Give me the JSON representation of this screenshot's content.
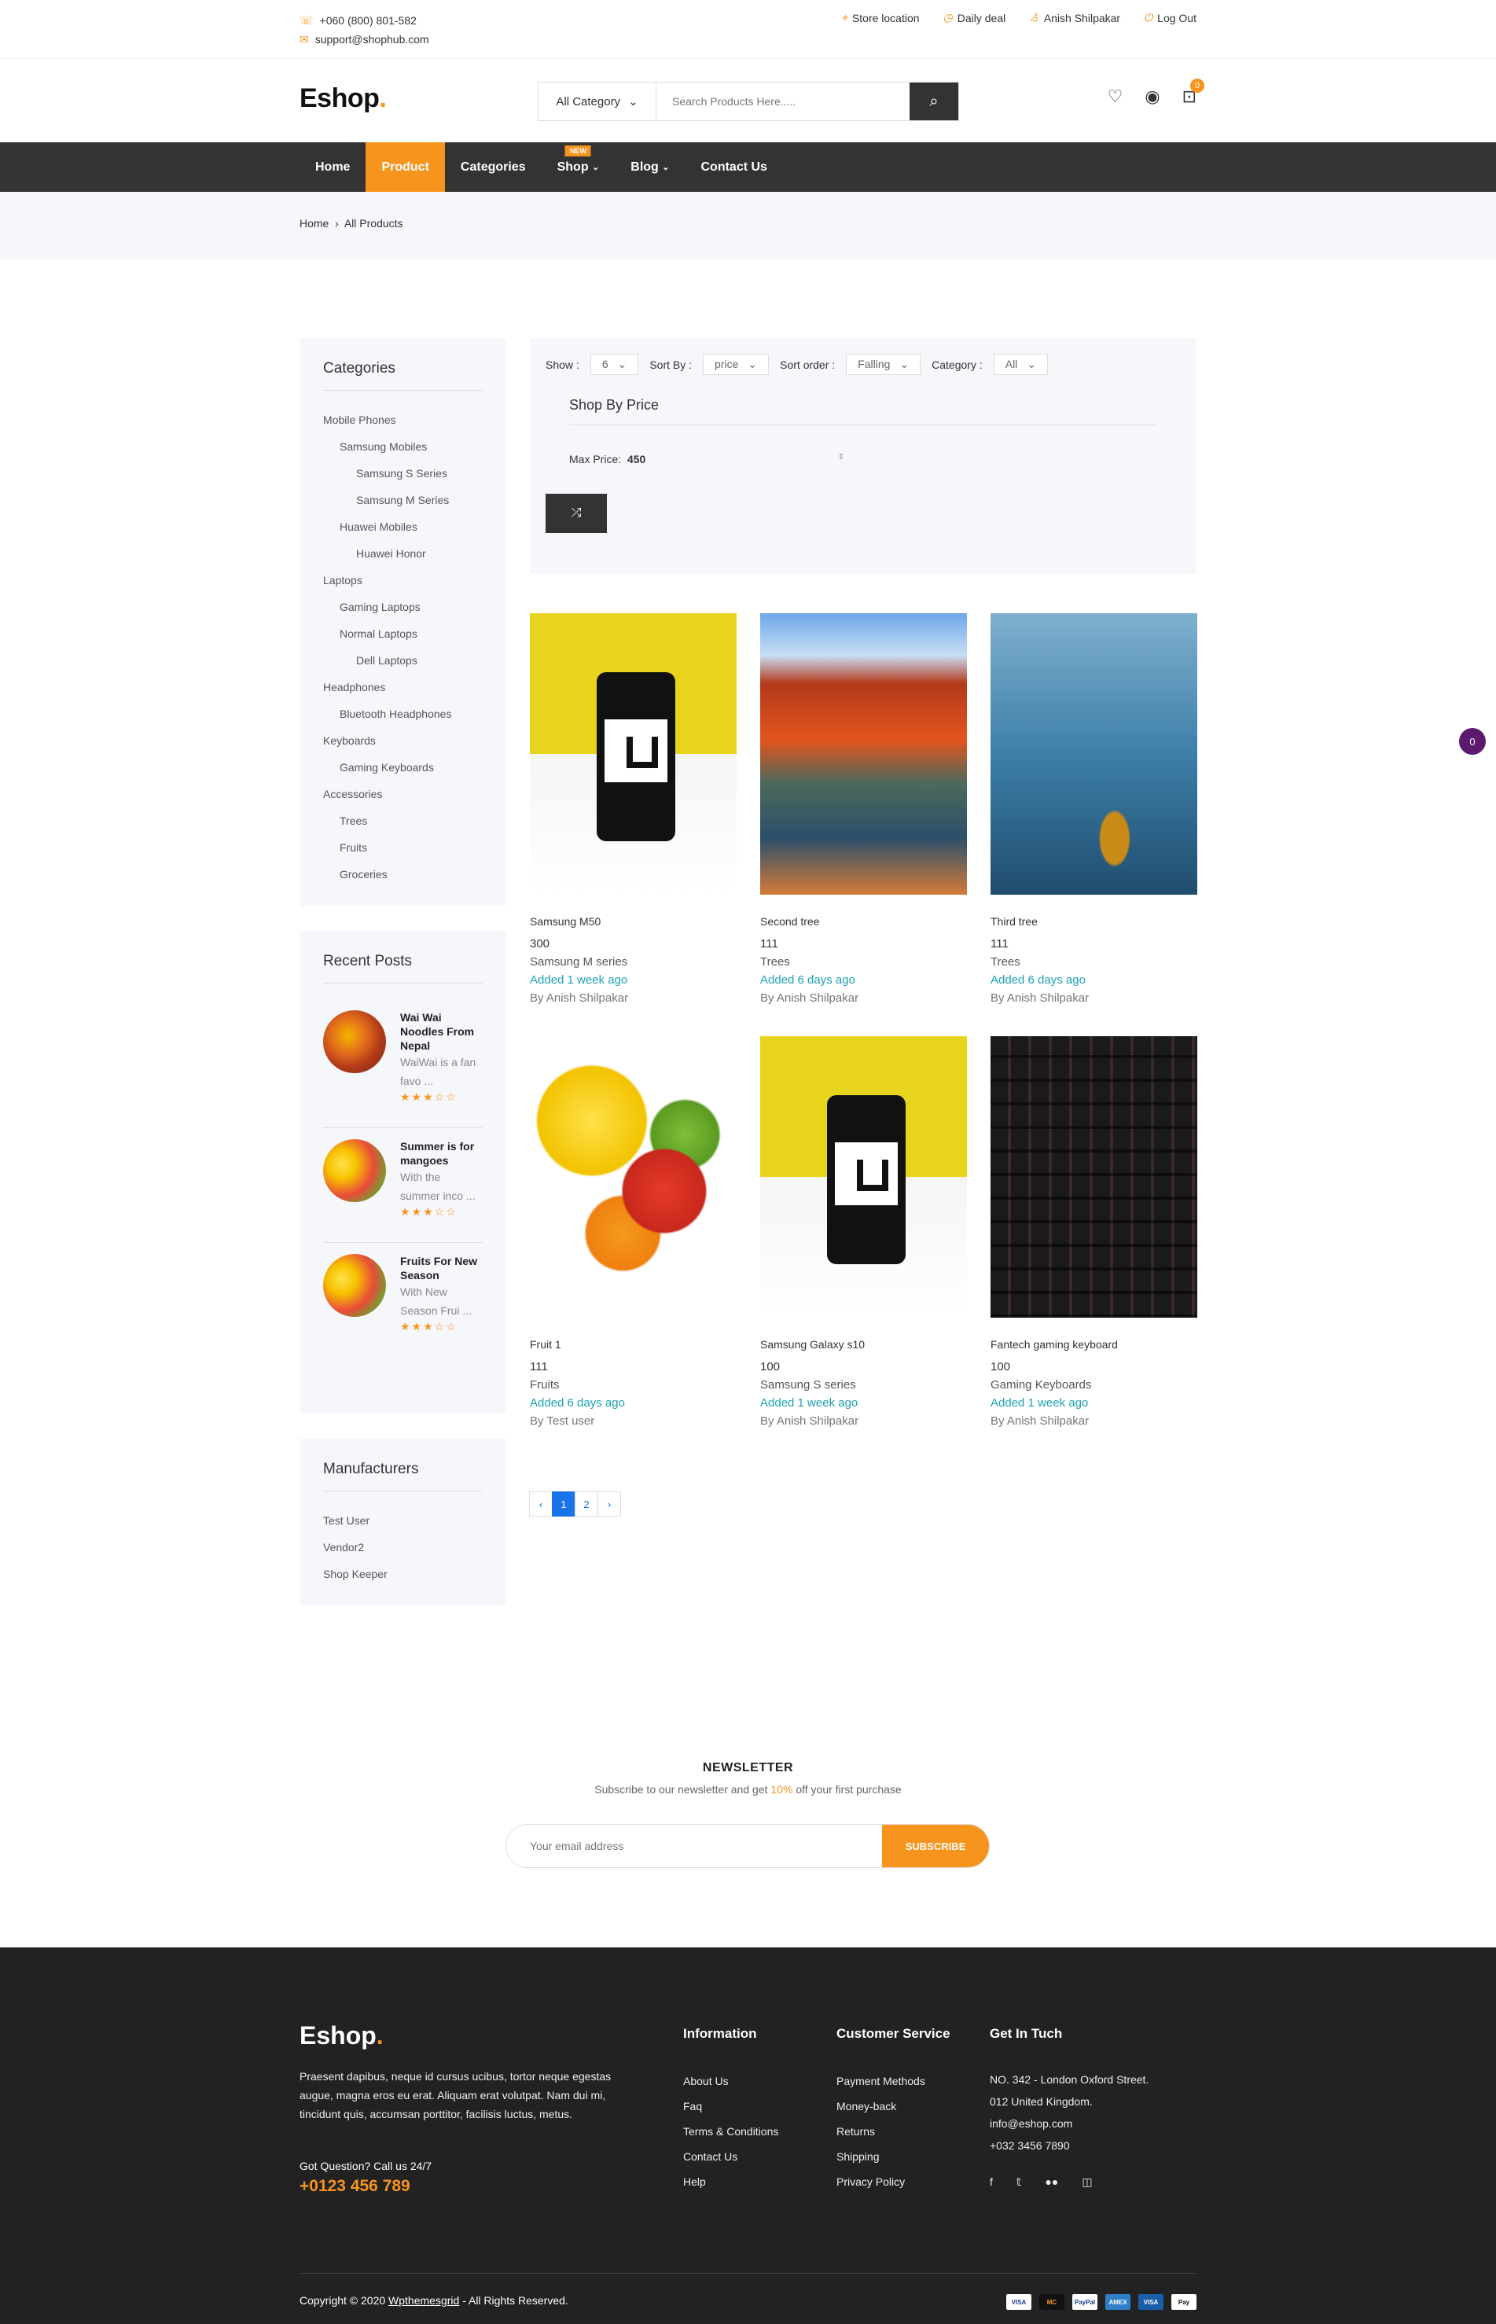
{
  "topbar": {
    "phone": "+060 (800) 801-582",
    "email": "support@shophub.com",
    "store_location": "Store location",
    "daily_deal": "Daily deal",
    "user": "Anish Shilpakar",
    "logout": "Log Out"
  },
  "header": {
    "logo": "Eshop",
    "logo_dot": ".",
    "category_select": "All Category",
    "search_placeholder": "Search Products Here.....",
    "cart_count": "0"
  },
  "nav": {
    "items": [
      {
        "label": "Home"
      },
      {
        "label": "Product"
      },
      {
        "label": "Categories"
      },
      {
        "label": "Shop",
        "badge": "NEW"
      },
      {
        "label": "Blog"
      },
      {
        "label": "Contact Us"
      }
    ]
  },
  "breadcrumb": {
    "home": "Home",
    "sep": "›",
    "current": "All Products"
  },
  "sidebar": {
    "categories_title": "Categories",
    "categories": [
      {
        "label": "Mobile Phones",
        "level": 0
      },
      {
        "label": "Samsung Mobiles",
        "level": 1
      },
      {
        "label": "Samsung S Series",
        "level": 2
      },
      {
        "label": "Samsung M Series",
        "level": 2
      },
      {
        "label": "Huawei Mobiles",
        "level": 1
      },
      {
        "label": "Huawei Honor",
        "level": 2
      },
      {
        "label": "Laptops",
        "level": 0
      },
      {
        "label": "Gaming Laptops",
        "level": 1
      },
      {
        "label": "Normal Laptops",
        "level": 1
      },
      {
        "label": "Dell Laptops",
        "level": 2
      },
      {
        "label": "Headphones",
        "level": 0
      },
      {
        "label": "Bluetooth Headphones",
        "level": 1
      },
      {
        "label": "Keyboards",
        "level": 0
      },
      {
        "label": "Gaming Keyboards",
        "level": 1
      },
      {
        "label": "Accessories",
        "level": 0
      },
      {
        "label": "Trees",
        "level": 1
      },
      {
        "label": "Fruits",
        "level": 1
      },
      {
        "label": "Groceries",
        "level": 1
      }
    ],
    "recent_title": "Recent Posts",
    "posts": [
      {
        "title": "Wai Wai Noodles From Nepal",
        "excerpt": "WaiWai is a fan favo ...",
        "stars": "★★★☆☆"
      },
      {
        "title": "Summer is for mangoes",
        "excerpt": "With the summer inco ...",
        "stars": "★★★☆☆"
      },
      {
        "title": "Fruits For New Season",
        "excerpt": "With New Season Frui ...",
        "stars": "★★★☆☆"
      }
    ],
    "manufacturers_title": "Manufacturers",
    "manufacturers": [
      "Test User",
      "Vendor2",
      "Shop Keeper"
    ]
  },
  "filter": {
    "show_label": "Show :",
    "show_value": "6",
    "sort_by_label": "Sort By :",
    "sort_by_value": "price",
    "sort_order_label": "Sort order :",
    "sort_order_value": "Falling",
    "category_label": "Category :",
    "category_value": "All",
    "shop_by_price": "Shop By Price",
    "max_price_label": "Max Price:",
    "max_price_value": "450"
  },
  "products": [
    {
      "title": "Samsung M50",
      "price": "300",
      "category": "Samsung M series",
      "added": "Added 1 week ago",
      "by": "By Anish Shilpakar"
    },
    {
      "title": "Second tree",
      "price": "111",
      "category": "Trees",
      "added": "Added 6 days ago",
      "by": "By Anish Shilpakar"
    },
    {
      "title": "Third tree",
      "price": "111",
      "category": "Trees",
      "added": "Added 6 days ago",
      "by": "By Anish Shilpakar"
    },
    {
      "title": "Fruit 1",
      "price": "111",
      "category": "Fruits",
      "added": "Added 6 days ago",
      "by": "By Test user"
    },
    {
      "title": "Samsung Galaxy s10",
      "price": "100",
      "category": "Samsung S series",
      "added": "Added 1 week ago",
      "by": "By Anish Shilpakar"
    },
    {
      "title": "Fantech gaming keyboard",
      "price": "100",
      "category": "Gaming Keyboards",
      "added": "Added 1 week ago",
      "by": "By Anish Shilpakar"
    }
  ],
  "pagination": {
    "prev": "‹",
    "pages": [
      "1",
      "2"
    ],
    "next": "›"
  },
  "newsletter": {
    "title": "NEWSLETTER",
    "text_before": "Subscribe to our newsletter and get ",
    "highlight": "10%",
    "text_after": " off your first purchase",
    "placeholder": "Your email address",
    "button": "SUBSCRIBE"
  },
  "footer": {
    "logo": "Eshop",
    "logo_dot": ".",
    "description": "Praesent dapibus, neque id cursus ucibus, tortor neque egestas augue, magna eros eu erat. Aliquam erat volutpat. Nam dui mi, tincidunt quis, accumsan porttitor, facilisis luctus, metus.",
    "question": "Got Question? Call us 24/7",
    "phone": "+0123 456 789",
    "info_title": "Information",
    "info_links": [
      "About Us",
      "Faq",
      "Terms & Conditions",
      "Contact Us",
      "Help"
    ],
    "service_title": "Customer Service",
    "service_links": [
      "Payment Methods",
      "Money-back",
      "Returns",
      "Shipping",
      "Privacy Policy"
    ],
    "contact_title": "Get In Tuch",
    "contact_lines": [
      "NO. 342 - London Oxford Street.",
      "012 United Kingdom.",
      "info@eshop.com",
      "+032 3456 7890"
    ],
    "copyright_before": "Copyright © 2020 ",
    "copyright_link": "Wpthemesgrid",
    "copyright_after": " - All Rights Reserved.",
    "payments": [
      "VISA",
      "MC",
      "PayPal",
      "AMEX",
      "VISA",
      "Pay"
    ]
  },
  "floating_badge": "0"
}
